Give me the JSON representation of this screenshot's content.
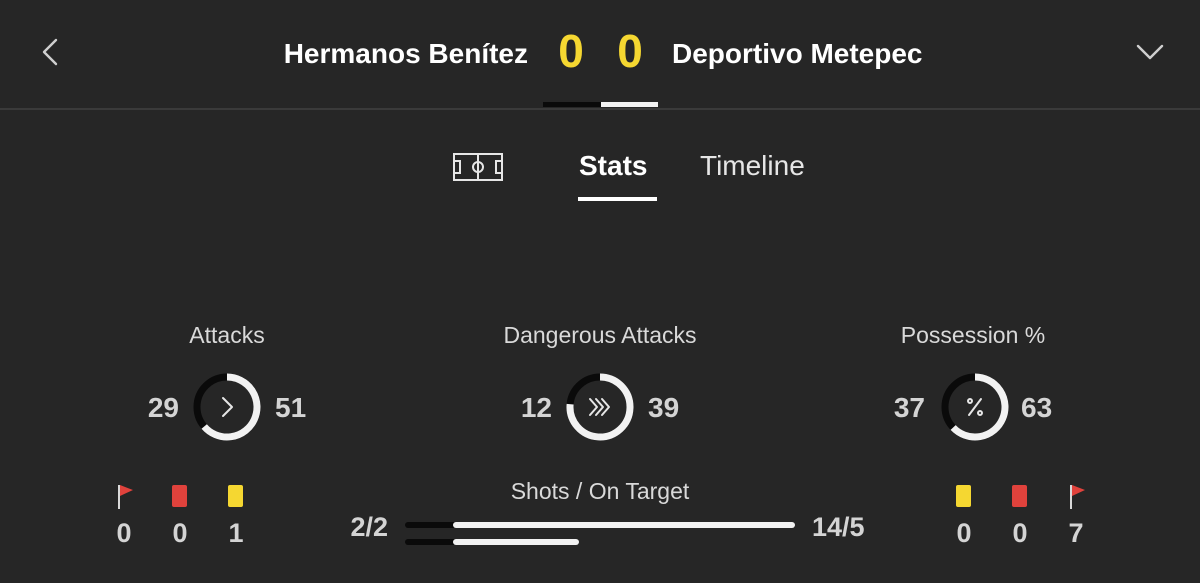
{
  "header": {
    "home_team": "Hermanos Benítez",
    "away_team": "Deportivo Metepec",
    "home_score": "0",
    "away_score": "0",
    "back_icon": "chevron-left-icon",
    "expand_icon": "chevron-down-icon"
  },
  "tabs": {
    "pitch_icon": "pitch-icon",
    "stats_label": "Stats",
    "timeline_label": "Timeline",
    "active": "Stats"
  },
  "stats": {
    "attacks": {
      "title": "Attacks",
      "home": 29,
      "away": 51,
      "icon": "chevron-right-icon"
    },
    "dangerous_attacks": {
      "title": "Dangerous Attacks",
      "home": 12,
      "away": 39,
      "icon": "double-chevron-right-icon"
    },
    "possession": {
      "title": "Possession %",
      "home": 37,
      "away": 63,
      "icon": "percent-icon"
    },
    "shots": {
      "title": "Shots / On Target",
      "home": "2/2",
      "away": "14/5",
      "home_shots": 2,
      "home_on_target": 2,
      "away_shots": 14,
      "away_on_target": 5
    }
  },
  "home_events": {
    "corners": "0",
    "red_cards": "0",
    "yellow_cards": "1"
  },
  "away_events": {
    "yellow_cards": "0",
    "red_cards": "0",
    "corners": "7"
  },
  "colors": {
    "background": "#262626",
    "score": "#f5d731",
    "home_bar": "#0a0a0a",
    "away_bar": "#f2f2f2",
    "red_card": "#e0423c",
    "yellow_card": "#f5d731",
    "flag": "#e0423c"
  }
}
